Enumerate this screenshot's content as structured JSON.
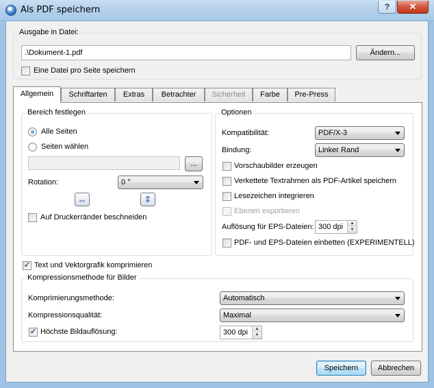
{
  "window": {
    "title": "Als PDF speichern",
    "help_glyph": "?",
    "close_glyph": "✕",
    "app_icon": "globe-icon"
  },
  "output": {
    "group_title": "Ausgabe in Datei:",
    "path": ".\\Dokument-1.pdf",
    "change_button": "Ändern...",
    "one_file_per_page_label": "Eine Datei pro Seite speichern",
    "one_file_per_page_checked": false
  },
  "tabs": [
    {
      "label": "Allgemein",
      "active": true,
      "enabled": true
    },
    {
      "label": "Schriftarten",
      "active": false,
      "enabled": true
    },
    {
      "label": "Extras",
      "active": false,
      "enabled": true
    },
    {
      "label": "Betrachter",
      "active": false,
      "enabled": true
    },
    {
      "label": "Sicherheit",
      "active": false,
      "enabled": false
    },
    {
      "label": "Farbe",
      "active": false,
      "enabled": true
    },
    {
      "label": "Pre-Press",
      "active": false,
      "enabled": true
    }
  ],
  "range": {
    "group_title": "Bereich festlegen",
    "all_pages_label": "Alle Seiten",
    "select_pages_label": "Seiten wählen",
    "selected": "all",
    "pages_value": "",
    "browse_button": "...",
    "rotation_label": "Rotation:",
    "rotation_value": "0 °",
    "rotate_horizontal_icon": "flip-horizontal-icon",
    "rotate_vertical_icon": "flip-vertical-icon",
    "crop_label": "Auf Druckerränder beschneiden",
    "crop_checked": false
  },
  "options": {
    "group_title": "Optionen",
    "compat_label": "Kompatibilität:",
    "compat_value": "PDF/X-3",
    "binding_label": "Bindung:",
    "binding_value": "Linker Rand",
    "thumbnails_label": "Vorschaubilder erzeugen",
    "articles_label": "Verkettete Textrahmen als PDF-Artikel speichern",
    "bookmarks_label": "Lesezeichen integrieren",
    "layers_label": "Ebenen exportieren",
    "eps_res_label": "Auflösung für EPS-Dateien:",
    "eps_res_value": "300 dpi",
    "embed_label": "PDF- und EPS-Dateien einbetten (EXPERIMENTELL)"
  },
  "compress": {
    "compress_text_label": "Text und Vektorgrafik komprimieren",
    "compress_text_checked": true,
    "group_title": "Kompressionsmethode für Bilder",
    "method_label": "Komprimierungsmethode:",
    "method_value": "Automatisch",
    "quality_label": "Kompressionsqualität:",
    "quality_value": "Maximal",
    "max_res_label": "Höchste Bildauflösung:",
    "max_res_checked": true,
    "max_res_value": "300 dpi"
  },
  "footer": {
    "save_button": "Speichern",
    "cancel_button": "Abbrechen"
  }
}
